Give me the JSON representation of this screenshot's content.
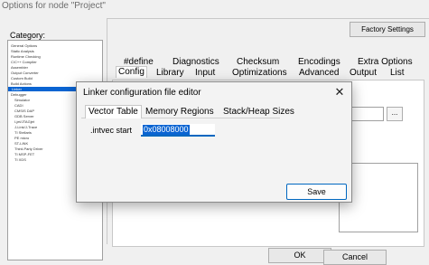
{
  "window": {
    "title": "Options for node \"Project\""
  },
  "category": {
    "label": "Category:",
    "items": [
      "General Options",
      "Static Analysis",
      "Runtime Checking",
      "C/C++ Compiler",
      "Assembler",
      "Output Converter",
      "Custom Build",
      "Build Actions",
      "Linker",
      "Debugger",
      "Simulator",
      "CADI",
      "CMSIS DAP",
      "GDB Server",
      "I-jet/JTAGjet",
      "J-Link/J-Trace",
      "TI Stellaris",
      "PE micro",
      "ST-LINK",
      "Third-Party Driver",
      "TI MSP-FET",
      "TI XDS"
    ],
    "selected_index": 8
  },
  "factory_settings_label": "Factory Settings",
  "tabs_row1": [
    "#define",
    "Diagnostics",
    "Checksum",
    "Encodings",
    "Extra Options"
  ],
  "tabs_row2": [
    "Config",
    "Library",
    "Input",
    "Optimizations",
    "Advanced",
    "Output",
    "List"
  ],
  "tabs_row2_active": "Config",
  "browse_label": "...",
  "buttons": {
    "ok": "OK",
    "cancel": "Cancel"
  },
  "dialog": {
    "title": "Linker configuration file editor",
    "close_glyph": "✕",
    "tabs": [
      "Vector Table",
      "Memory Regions",
      "Stack/Heap Sizes"
    ],
    "active_tab": "Vector Table",
    "field_label": ".intvec start",
    "field_value": "0x08008000",
    "save_label": "Save"
  }
}
